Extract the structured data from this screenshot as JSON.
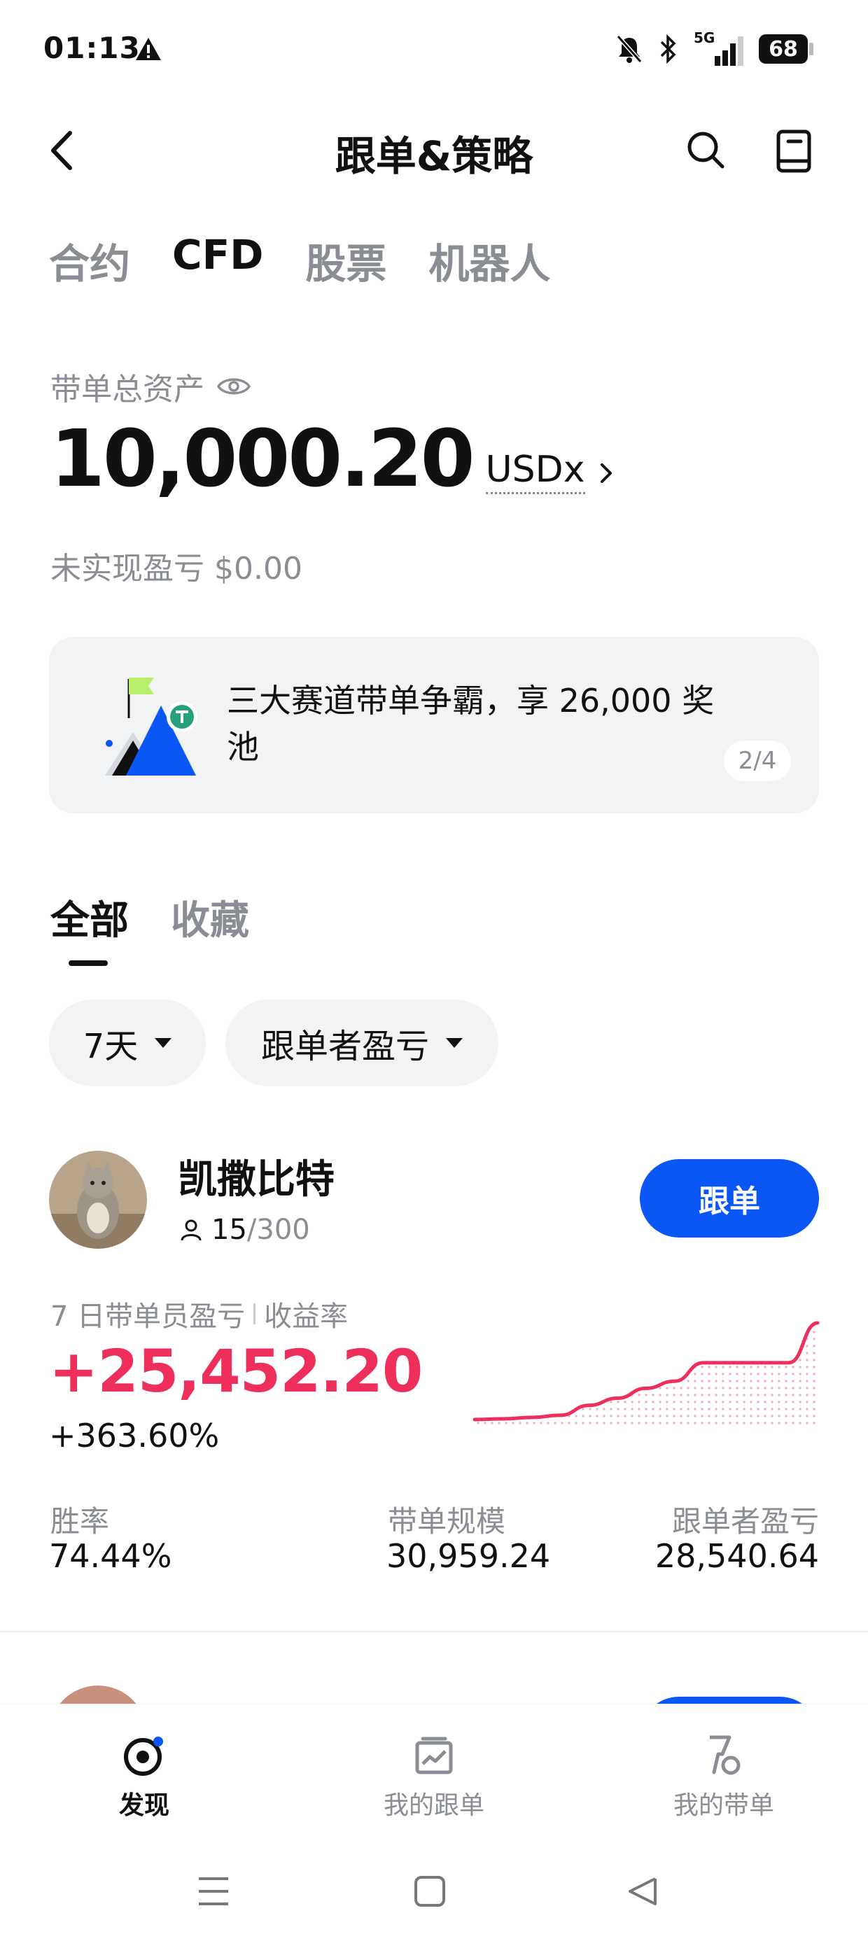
{
  "status_bar": {
    "time": "01:13",
    "signal": "5G",
    "battery": "68"
  },
  "header": {
    "title": "跟单&策略"
  },
  "product_tabs": [
    {
      "label": "合约",
      "active": false
    },
    {
      "label": "CFD",
      "active": true
    },
    {
      "label": "股票",
      "active": false
    },
    {
      "label": "机器人",
      "active": false
    }
  ],
  "assets": {
    "label": "带单总资产",
    "amount": "10,000.20",
    "currency": "USDx",
    "unrealized_label": "未实现盈亏",
    "unrealized_value": "$0.00"
  },
  "banner": {
    "text": "三大赛道带单争霸，享 26,000 奖池",
    "page": "2/4"
  },
  "list_tabs": [
    {
      "label": "全部",
      "active": true
    },
    {
      "label": "收藏",
      "active": false
    }
  ],
  "filters": {
    "period": "7天",
    "sort": "跟单者盈亏"
  },
  "trader": {
    "name": "凯撒比特",
    "followers": "15",
    "followers_max": "/300",
    "follow_label": "跟单",
    "pnl_label": "7 日带单员盈亏",
    "roi_label": "收益率",
    "pnl": "+25,452.20",
    "roi": "+363.60%",
    "stats": [
      {
        "label": "胜率",
        "value": "74.44%"
      },
      {
        "label": "带单规模",
        "value": "30,959.24"
      },
      {
        "label": "跟单者盈亏",
        "value": "28,540.64"
      }
    ],
    "sparkline": [
      0,
      0.5,
      1.5,
      3,
      10,
      15,
      22,
      27,
      40,
      40,
      40,
      40,
      68
    ]
  },
  "bottom_nav": [
    {
      "label": "发现",
      "active": true,
      "icon": "discover-icon"
    },
    {
      "label": "我的跟单",
      "active": false,
      "icon": "chart-box-icon"
    },
    {
      "label": "我的带单",
      "active": false,
      "icon": "trophy-icon"
    }
  ],
  "colors": {
    "accent": "#0a57f5",
    "profit": "#ee2f5b",
    "muted": "#8a8d93",
    "chip_bg": "#f2f3f5"
  }
}
